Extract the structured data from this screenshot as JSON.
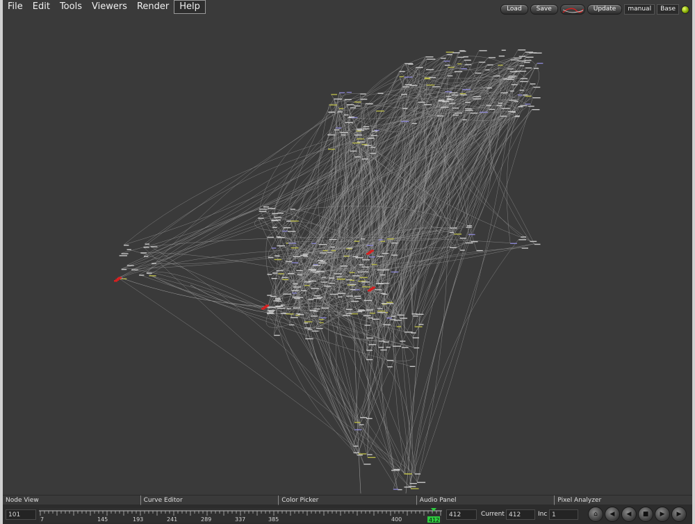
{
  "menu": {
    "items": [
      "File",
      "Edit",
      "Tools",
      "Viewers",
      "Render",
      "Help"
    ]
  },
  "toolbar": {
    "load_label": "Load",
    "save_label": "Save",
    "update_label": "Update",
    "mode_label": "manual",
    "base_label": "Base",
    "status_color": "#9acd00"
  },
  "node_view": {
    "highlight_color": "#d42020",
    "edge_color": "#9a9a9a",
    "node_label_color": "#c8c8c8",
    "accent_label_color": "#b8b84a",
    "selected_label_color": "#8a86d0"
  },
  "panels": {
    "tabs": [
      "Node View",
      "Curve Editor",
      "Color Picker",
      "Audio Panel",
      "Pixel Analyzer"
    ]
  },
  "timeline": {
    "start_value": "101",
    "end_value": "412",
    "current_label": "Current",
    "current_value": "412",
    "inc_label": "Inc",
    "inc_value": "1",
    "ruler_labels": [
      "7",
      "145",
      "193",
      "241",
      "289",
      "337",
      "385",
      "400"
    ],
    "marker_value": "412",
    "marker_color": "#2ecc40",
    "transport": [
      "home-icon",
      "key-prev-icon",
      "step-back-icon",
      "stop-icon",
      "play-icon",
      "key-next-icon"
    ]
  }
}
